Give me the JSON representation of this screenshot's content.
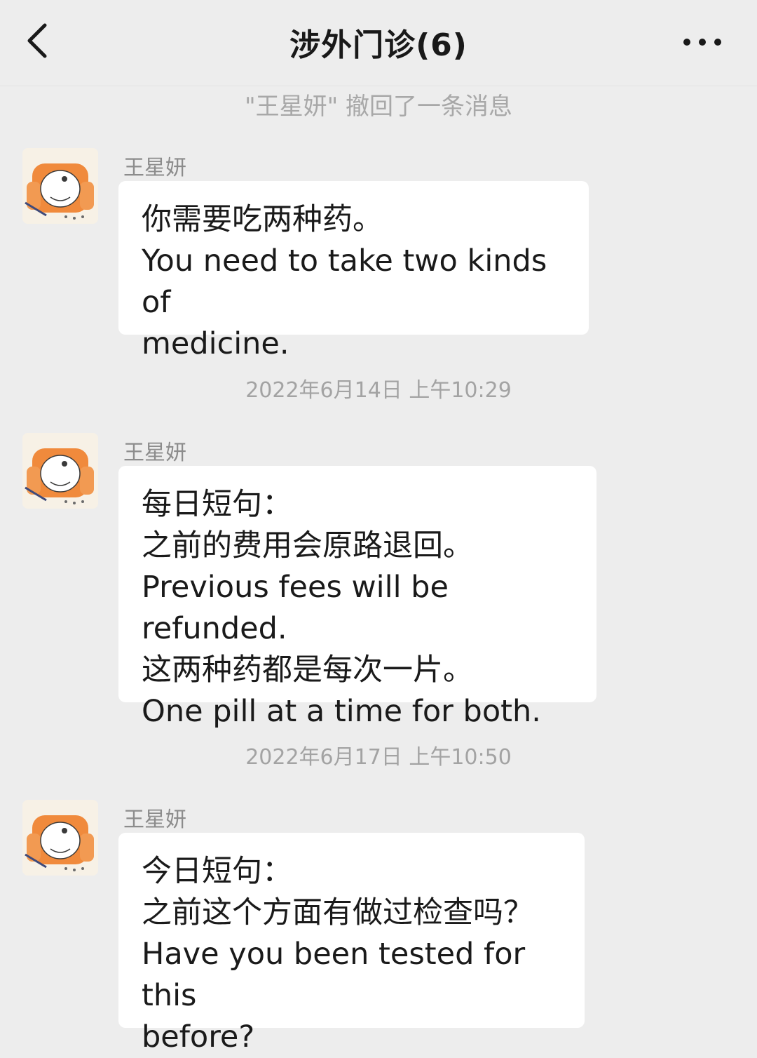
{
  "header": {
    "title": "涉外门诊(6)"
  },
  "system_message": "\"王星妍\" 撤回了一条消息",
  "messages": [
    {
      "sender": "王星妍",
      "lines": [
        "你需要吃两种药。",
        "You need to take two kinds of",
        "medicine."
      ]
    },
    {
      "timestamp": "2022年6月14日 上午10:29",
      "sender": "王星妍",
      "lines": [
        "每日短句：",
        "之前的费用会原路退回。",
        "Previous fees will be refunded.",
        "这两种药都是每次一片。",
        "One pill at a time for both."
      ]
    },
    {
      "timestamp": "2022年6月17日 上午10:50",
      "sender": "王星妍",
      "lines": [
        "今日短句：",
        "之前这个方面有做过检查吗？",
        "Have you been tested for this",
        "before?"
      ]
    }
  ],
  "icons": {
    "back": "chevron-left-icon",
    "more": "more-dots-icon",
    "avatar": "cartoon-armchair-avatar"
  },
  "colors": {
    "background": "#EDEDED",
    "bubble": "#FFFFFF",
    "avatar_accent": "#F08A3C"
  }
}
